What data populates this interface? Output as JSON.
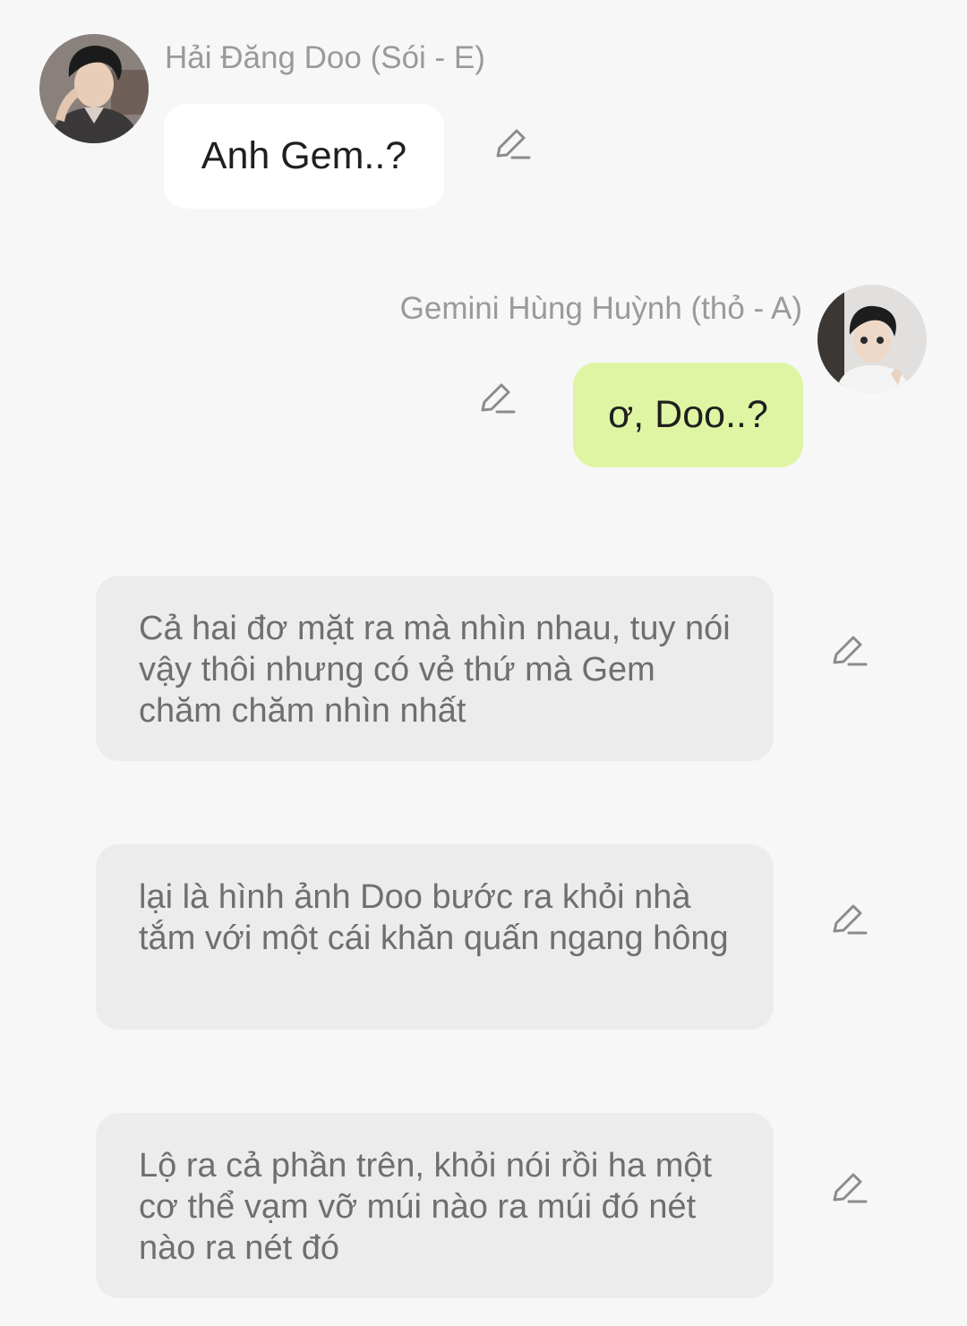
{
  "messages": [
    {
      "sender": "Hải Đăng Doo (Sói - E)",
      "text": "Anh Gem..?",
      "side": "left"
    },
    {
      "sender": "Gemini Hùng Huỳnh (thỏ - A)",
      "text": "ơ, Doo..?",
      "side": "right"
    }
  ],
  "narrations": [
    {
      "text": "Cả hai đơ mặt ra mà nhìn nhau, tuy nói vậy thôi nhưng có vẻ thứ mà Gem chăm chăm nhìn nhất"
    },
    {
      "text": "lại là hình ảnh Doo bước ra khỏi nhà tắm với một cái khăn quấn ngang hông"
    },
    {
      "text": "Lộ ra cả phần trên, khỏi nói rồi ha một cơ thể vạm vỡ múi nào ra múi đó nét nào ra nét đó"
    }
  ],
  "icons": {
    "edit": "pencil-edit-icon",
    "avatar_1": "avatar-photo",
    "avatar_2": "avatar-photo"
  },
  "colors": {
    "background": "#f7f7f7",
    "bubble_left": "#ffffff",
    "bubble_right": "#dff5a4",
    "narration_bg": "#ececec",
    "name_text": "#9a9a9a"
  }
}
